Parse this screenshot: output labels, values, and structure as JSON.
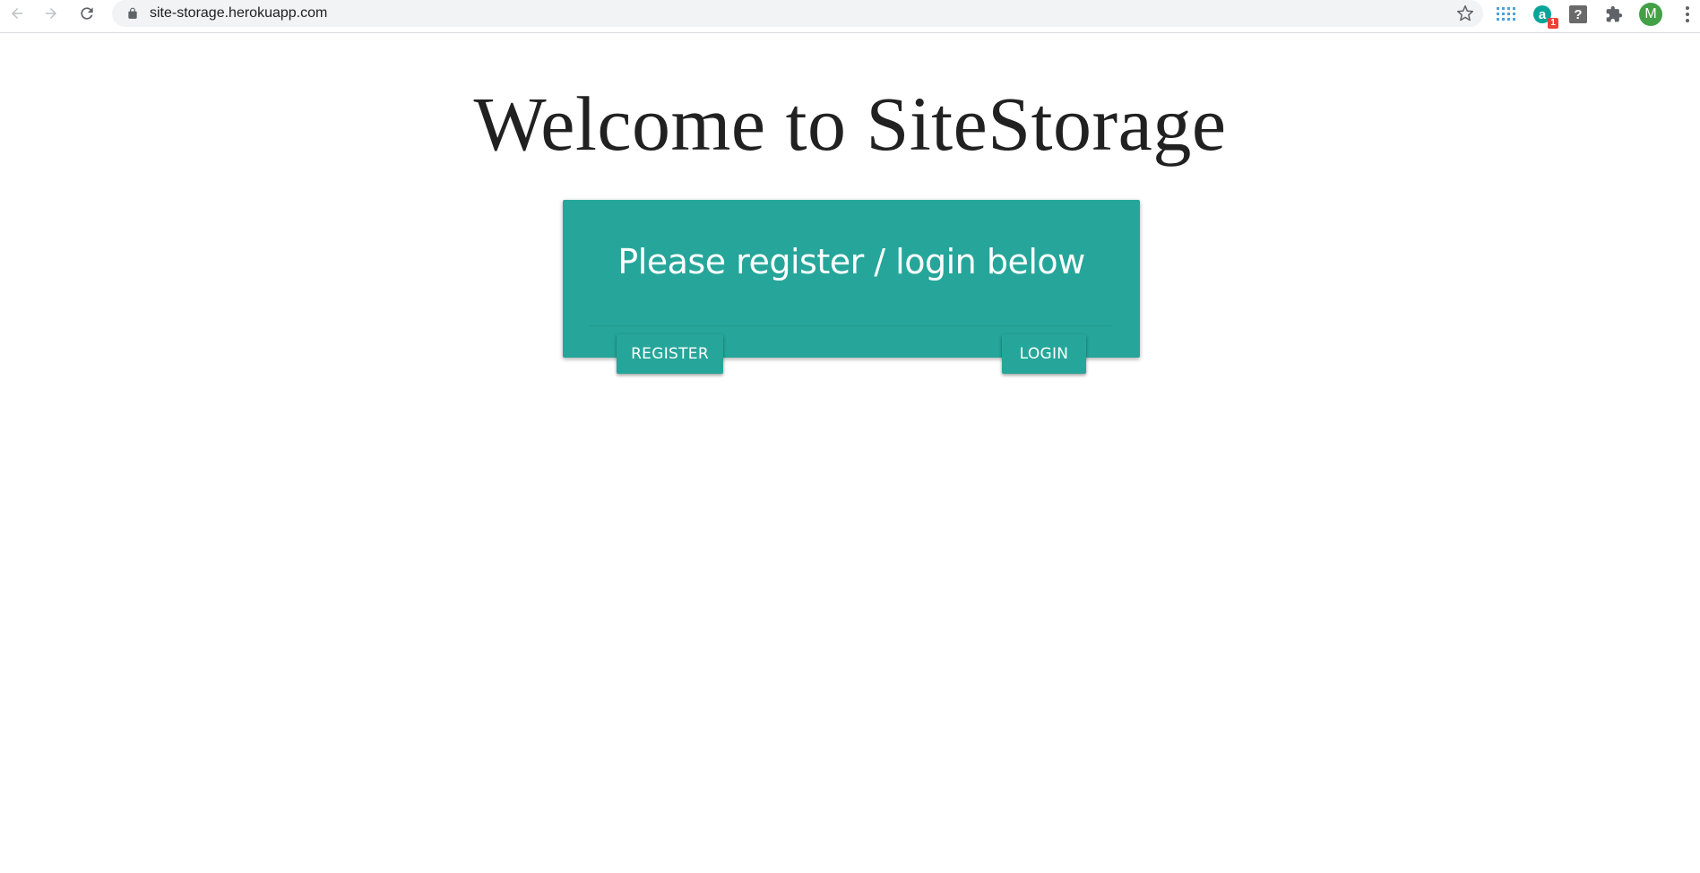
{
  "browser": {
    "url": "site-storage.herokuapp.com",
    "extension_badge": "1",
    "extension_q_label": "?",
    "extension_a_label": "a",
    "avatar_initial": "M"
  },
  "main": {
    "heading": "Welcome to SiteStorage",
    "card": {
      "title": "Please register / login below",
      "register_label": "REGISTER",
      "login_label": "LOGIN",
      "background_color": "#26a69a"
    }
  },
  "icons": {
    "back": "arrow-left-icon",
    "forward": "arrow-right-icon",
    "reload": "reload-icon",
    "lock": "lock-icon",
    "bookmark": "star-icon",
    "apps": "apps-grid-icon",
    "extensions": "puzzle-icon",
    "menu": "kebab-menu-icon"
  }
}
